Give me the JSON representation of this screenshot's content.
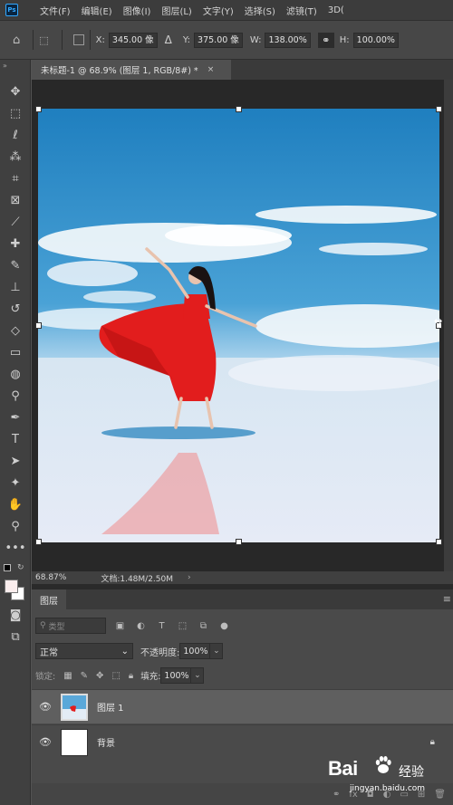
{
  "app": {
    "logo_text": "Ps"
  },
  "menu": [
    "文件(F)",
    "编辑(E)",
    "图像(I)",
    "图层(L)",
    "文字(Y)",
    "选择(S)",
    "滤镜(T)",
    "3D("
  ],
  "options": {
    "x_label": "X:",
    "x_value": "345.00 像",
    "delta_symbol": "Δ",
    "y_label": "Y:",
    "y_value": "375.00 像",
    "w_label": "W:",
    "w_value": "138.00%",
    "h_label": "H:",
    "h_value": "100.00%",
    "link_icon": "link-icon"
  },
  "document": {
    "tab_title": "未标题-1 @ 68.9% (图层 1, RGB/8#) *",
    "close_glyph": "×"
  },
  "status": {
    "zoom": "68.87%",
    "doc_info": "文档:1.48M/2.50M",
    "arrow": "›"
  },
  "layers_panel": {
    "tab_label": "图层",
    "filter_placeholder": "类型",
    "blend_mode": "正常",
    "opacity_label": "不透明度:",
    "opacity_value": "100%",
    "lock_label": "锁定:",
    "fill_label": "填充:",
    "fill_value": "100%",
    "layers": [
      {
        "name": "图层 1",
        "selected": true,
        "visible": true
      },
      {
        "name": "背景",
        "selected": false,
        "visible": true,
        "locked": true
      }
    ]
  },
  "watermark": {
    "logo": "Bai",
    "suffix": "经验",
    "url": "jingyan.baidu.com"
  },
  "colors": {
    "foreground": "#fbeeee",
    "background": "#ffffff",
    "accent": "#31a8ff"
  }
}
